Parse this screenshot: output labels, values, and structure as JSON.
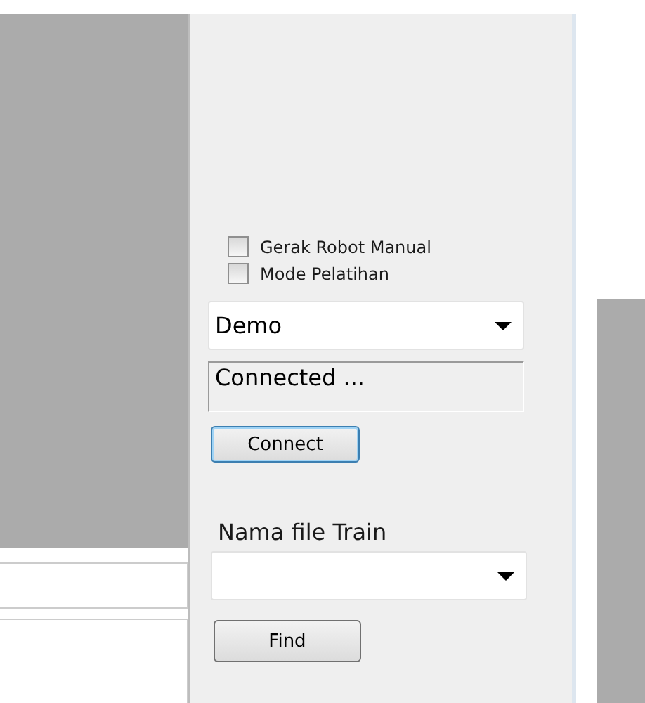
{
  "options": [
    {
      "label": "Gerak Robot Manual",
      "checked": false
    },
    {
      "label": "Mode Pelatihan",
      "checked": false
    }
  ],
  "port_select": {
    "value": "Demo"
  },
  "status_field": {
    "value": "Connected ..."
  },
  "connect_button": {
    "label": "Connect",
    "focused": true
  },
  "train_file": {
    "label": "Nama file Train"
  },
  "find_button": {
    "label": "Find"
  }
}
